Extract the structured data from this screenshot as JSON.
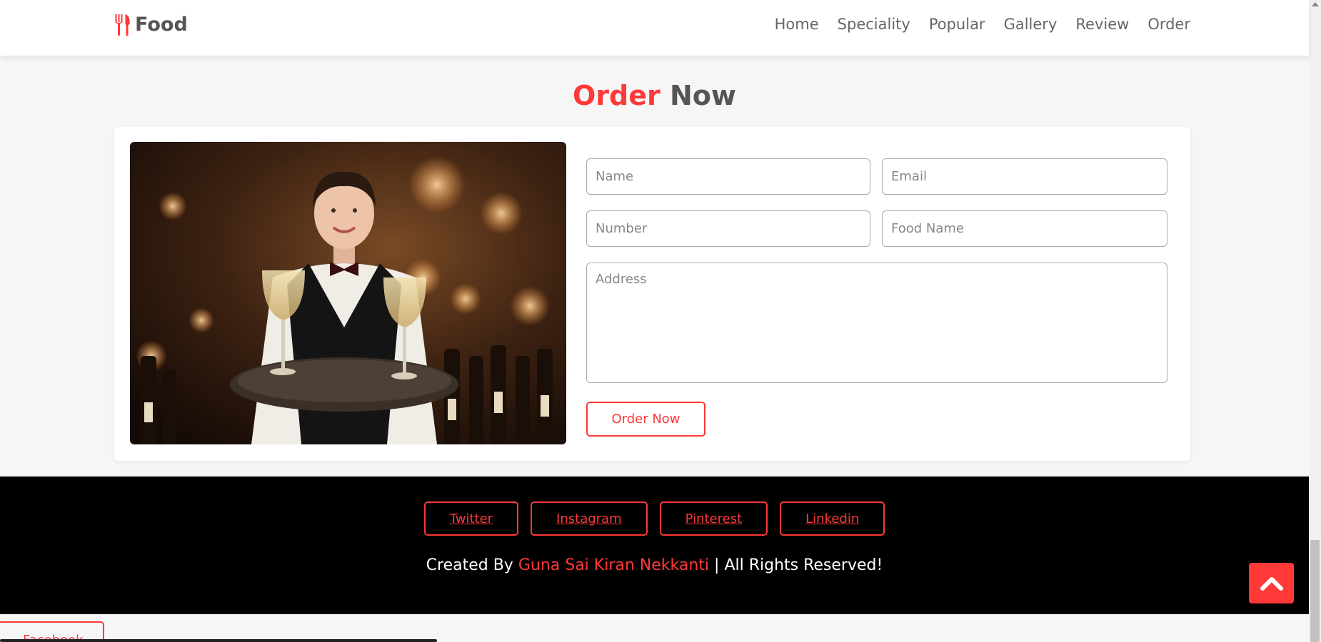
{
  "header": {
    "logo_text": "Food",
    "logo_icon": "utensils-icon",
    "nav": [
      "Home",
      "Speciality",
      "Popular",
      "Gallery",
      "Review",
      "Order"
    ]
  },
  "order": {
    "heading_accent": "Order",
    "heading_rest": " Now",
    "image_alt": "waiter-with-wine-glasses",
    "placeholders": {
      "name": "Name",
      "email": "Email",
      "number": "Number",
      "food": "Food Name",
      "address": "Address"
    },
    "submit_label": "Order Now"
  },
  "footer": {
    "social": [
      "Twitter",
      "Instagram",
      "Pinterest",
      "Linkedin"
    ],
    "credit_prefix": "Created By ",
    "credit_author": "Guna Sai Kiran Nekkanti",
    "credit_suffix": " | All Rights Reserved!"
  },
  "partial": {
    "facebook_label": "Facebook"
  },
  "colors": {
    "accent": "#ff3838",
    "text": "#555555",
    "footer_bg": "#000000",
    "page_bg": "#f6f6f6"
  }
}
